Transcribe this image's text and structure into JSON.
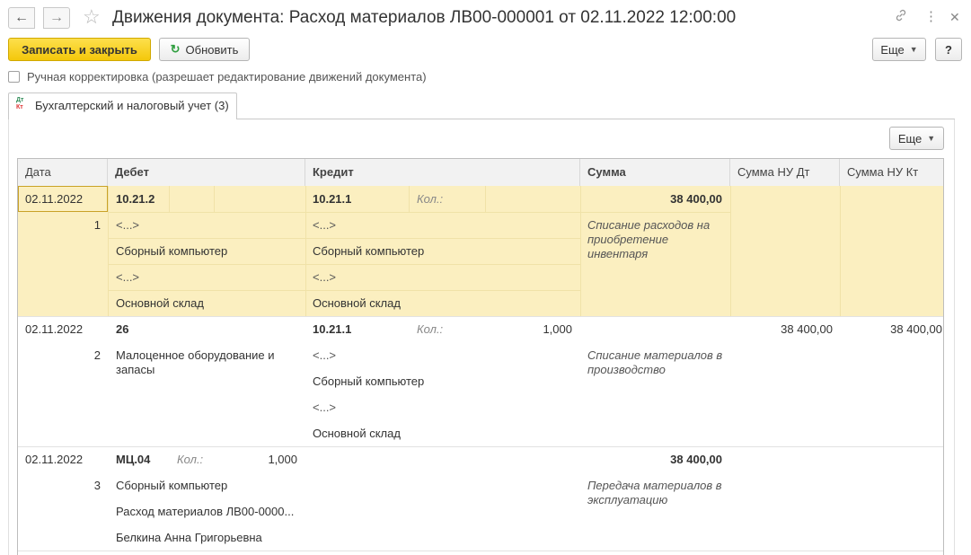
{
  "window": {
    "title": "Движения документа: Расход материалов ЛВ00-000001 от 02.11.2022 12:00:00",
    "icons": {
      "back": "arrow-left-icon",
      "forward": "arrow-right-icon",
      "favorite": "star-icon",
      "link": "link-icon",
      "more": "more-vertical-icon",
      "close": "close-icon"
    }
  },
  "toolbar": {
    "save_close_label": "Записать и закрыть",
    "refresh_label": "Обновить",
    "more_label": "Еще",
    "help_label": "?"
  },
  "manual_correction": {
    "label": "Ручная корректировка (разрешает редактирование движений документа)",
    "checked": false
  },
  "tab": {
    "label": "Бухгалтерский и налоговый учет (3)",
    "icon_dt": "Дт",
    "icon_kt": "Кт"
  },
  "table_toolbar": {
    "more_label": "Еще"
  },
  "table": {
    "columns": [
      "Дата",
      "Дебет",
      "Кредит",
      "Сумма",
      "Сумма НУ Дт",
      "Сумма НУ Кт"
    ],
    "rows": [
      {
        "date": "02.11.2022",
        "number": "1",
        "debit": {
          "account": "10.21.2",
          "lines": [
            "<...>",
            "Сборный компьютер",
            "<...>",
            "Основной склад"
          ]
        },
        "credit": {
          "account": "10.21.1",
          "qty_label": "Кол.:",
          "qty": "",
          "lines": [
            "<...>",
            "Сборный компьютер",
            "<...>",
            "Основной склад"
          ]
        },
        "sum": "38 400,00",
        "content": "Списание расходов на приобретение инвентаря",
        "sum_nu_dt": "",
        "sum_nu_kt": ""
      },
      {
        "date": "02.11.2022",
        "number": "2",
        "debit": {
          "account": "26",
          "lines": [
            "Малоценное оборудование и запасы"
          ]
        },
        "credit": {
          "account": "10.21.1",
          "qty_label": "Кол.:",
          "qty": "1,000",
          "lines": [
            "<...>",
            "Сборный компьютер",
            "<...>",
            "Основной склад"
          ]
        },
        "sum": "",
        "content": "Списание материалов в производство",
        "sum_nu_dt": "38 400,00",
        "sum_nu_kt": "38 400,00"
      },
      {
        "date": "02.11.2022",
        "number": "3",
        "debit": {
          "account": "МЦ.04",
          "qty_label": "Кол.:",
          "qty": "1,000",
          "lines": [
            "Сборный компьютер",
            "Расход материалов ЛВ00-0000...",
            "Белкина Анна Григорьевна"
          ]
        },
        "credit": {
          "account": "",
          "lines": []
        },
        "sum": "38 400,00",
        "content": "Передача материалов в эксплуатацию",
        "sum_nu_dt": "",
        "sum_nu_kt": ""
      }
    ]
  }
}
